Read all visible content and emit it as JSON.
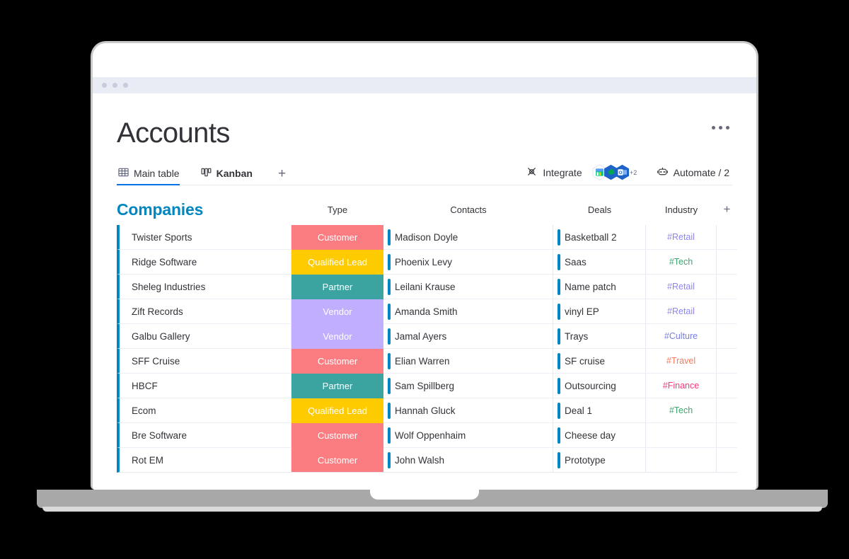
{
  "window": {
    "dots_count": 3
  },
  "header": {
    "title": "Accounts",
    "kebab_label": "More options"
  },
  "tabs": {
    "items": [
      {
        "label": "Main table",
        "icon": "table-grid-icon",
        "active": true
      },
      {
        "label": "Kanban",
        "icon": "kanban-board-icon",
        "active": false
      }
    ],
    "add_label": "+"
  },
  "toolbar": {
    "integrate_label": "Integrate",
    "integrate_icon": "integrate-plug-icon",
    "apps_overflow": "+2",
    "apps": [
      {
        "name": "monday-app-icon",
        "colors": [
          "#579bfc",
          "#ffcb00",
          "#00c875"
        ]
      },
      {
        "name": "gmail-app-icon",
        "colors": [
          "#1a73e8",
          "#00a651"
        ]
      },
      {
        "name": "outlook-app-icon",
        "colors": [
          "#0f6cbd",
          "#ffffff"
        ]
      }
    ],
    "automate_label": "Automate / 2",
    "automate_icon": "robot-icon"
  },
  "table": {
    "group_title": "Companies",
    "columns": [
      {
        "key": "company",
        "label": ""
      },
      {
        "key": "type",
        "label": "Type"
      },
      {
        "key": "contact",
        "label": "Contacts"
      },
      {
        "key": "deal",
        "label": "Deals"
      },
      {
        "key": "industry",
        "label": "Industry"
      },
      {
        "key": "add",
        "label": "+"
      }
    ],
    "type_colors": {
      "Customer": "#fb7c81",
      "Qualified Lead": "#fdcb00",
      "Partner": "#3ba4a0",
      "Vendor": "#c1aeff"
    },
    "industry_colors": {
      "#Retail": "#8e86e8",
      "#Tech": "#3fa66f",
      "#Culture": "#7a7fe0",
      "#Travel": "#f97a5b",
      "#Finance": "#f4397a"
    },
    "accent_bar_color": "#0086c0",
    "rows": [
      {
        "company": "Twister Sports",
        "type": "Customer",
        "contact": "Madison Doyle",
        "deal": "Basketball 2",
        "industry": "#Retail"
      },
      {
        "company": "Ridge Software",
        "type": "Qualified Lead",
        "contact": "Phoenix Levy",
        "deal": "Saas",
        "industry": "#Tech"
      },
      {
        "company": "Sheleg Industries",
        "type": "Partner",
        "contact": "Leilani Krause",
        "deal": "Name patch",
        "industry": "#Retail"
      },
      {
        "company": "Zift Records",
        "type": "Vendor",
        "contact": "Amanda Smith",
        "deal": "vinyl EP",
        "industry": "#Retail"
      },
      {
        "company": "Galbu Gallery",
        "type": "Vendor",
        "contact": "Jamal Ayers",
        "deal": "Trays",
        "industry": "#Culture"
      },
      {
        "company": "SFF Cruise",
        "type": "Customer",
        "contact": "Elian Warren",
        "deal": "SF cruise",
        "industry": "#Travel"
      },
      {
        "company": "HBCF",
        "type": "Partner",
        "contact": "Sam Spillberg",
        "deal": "Outsourcing",
        "industry": "#Finance"
      },
      {
        "company": "Ecom",
        "type": "Qualified Lead",
        "contact": "Hannah Gluck",
        "deal": "Deal 1",
        "industry": "#Tech"
      },
      {
        "company": "Bre Software",
        "type": "Customer",
        "contact": "Wolf Oppenhaim",
        "deal": "Cheese day",
        "industry": ""
      },
      {
        "company": "Rot EM",
        "type": "Customer",
        "contact": "John Walsh",
        "deal": "Prototype",
        "industry": ""
      }
    ]
  }
}
